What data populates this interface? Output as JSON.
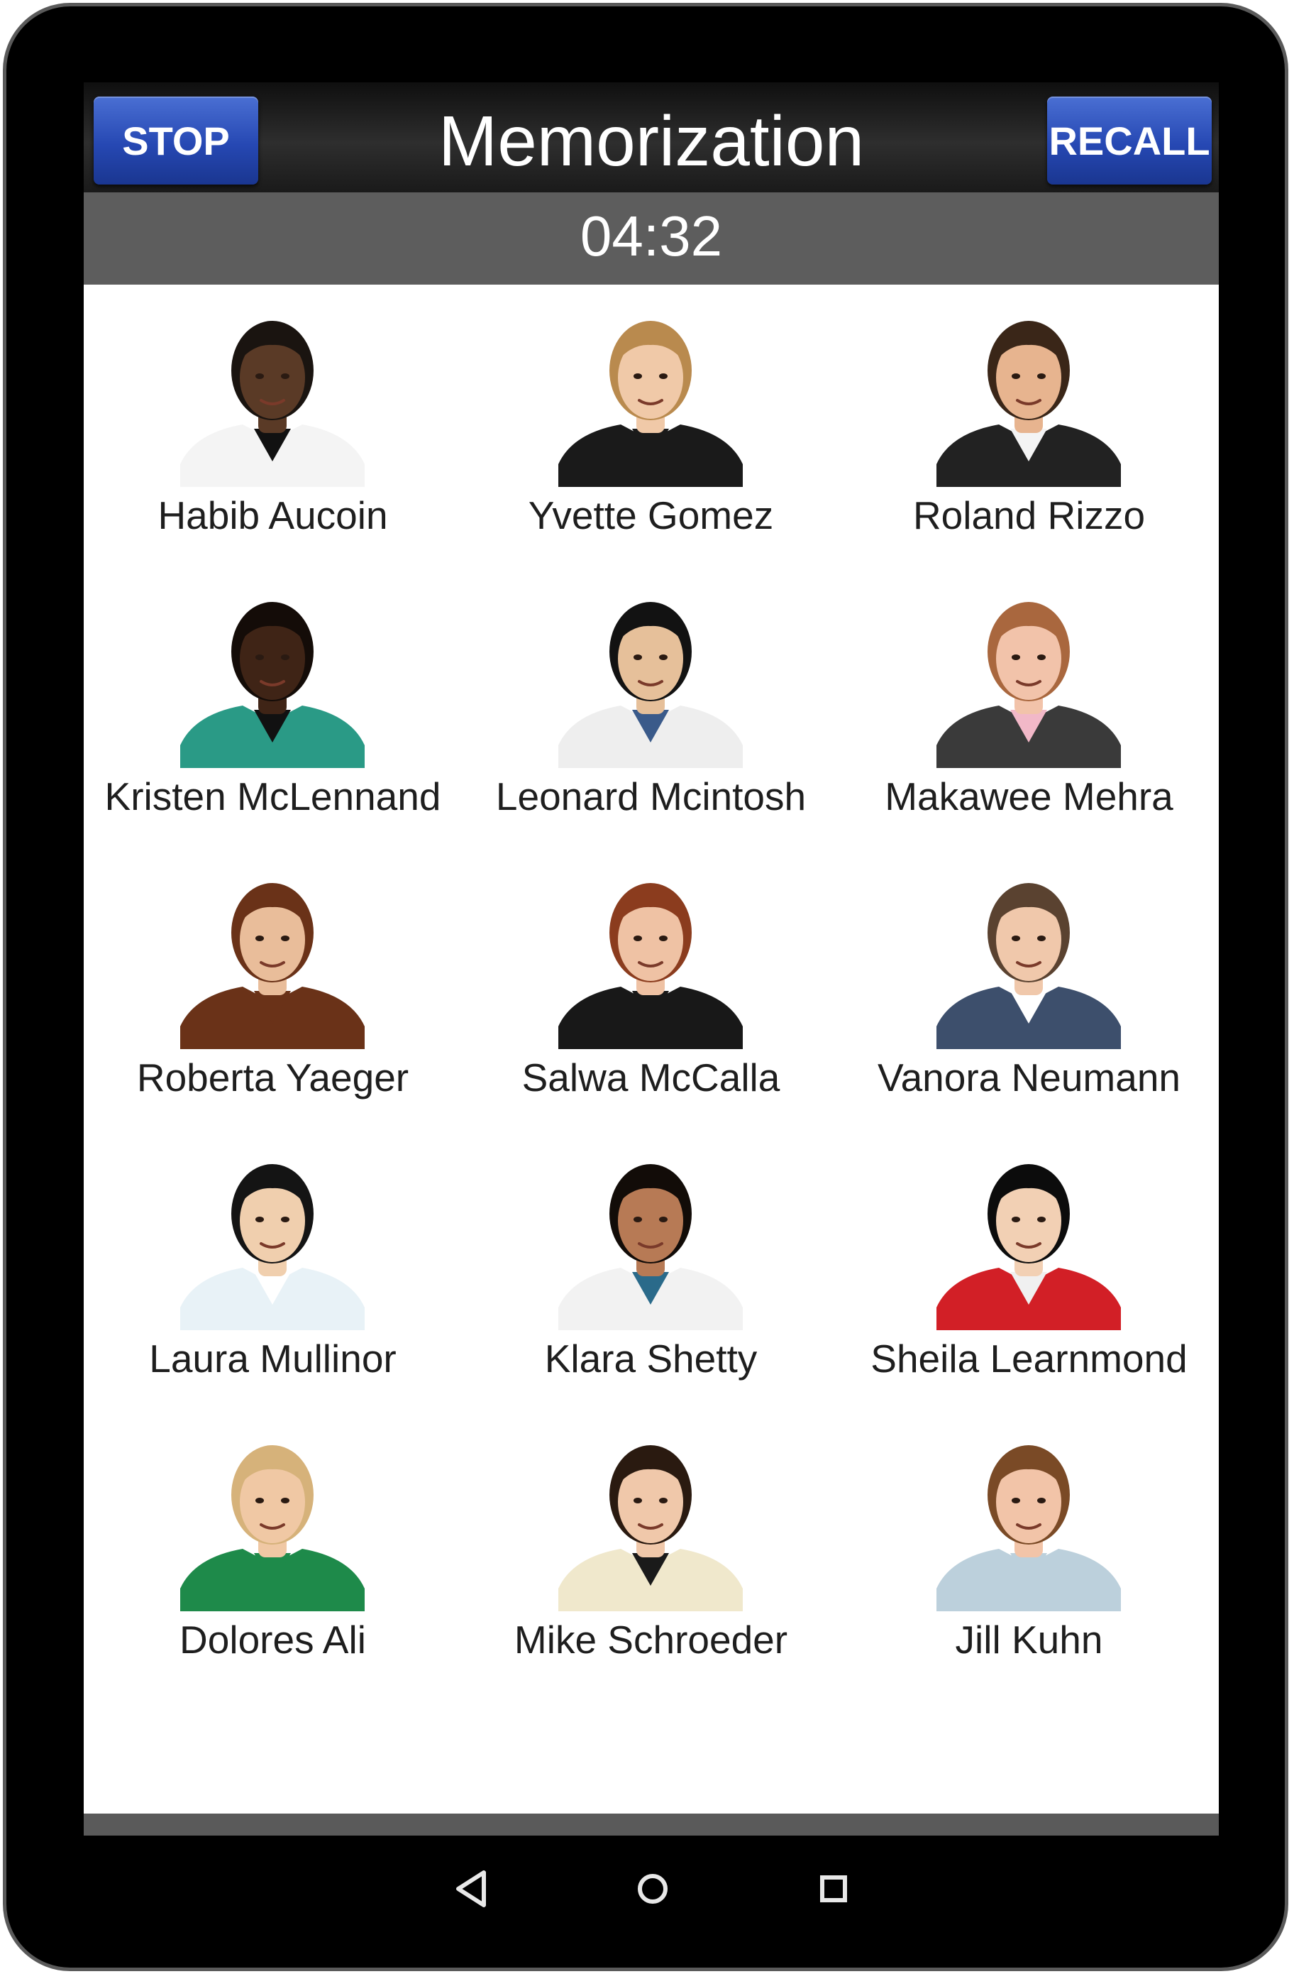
{
  "header": {
    "title": "Memorization",
    "stop_label": "STOP",
    "recall_label": "RECALL"
  },
  "timer": "04:32",
  "colors": {
    "button_blue": "#2648b3",
    "header_dark": "#1a1a1a",
    "timer_bar": "#5d5d5d"
  },
  "people": [
    {
      "name": "Habib Aucoin",
      "skin": "#5a3a26",
      "hair": "#1a1410",
      "shirt": "#f4f4f4",
      "shirt2": "#111111"
    },
    {
      "name": "Yvette Gomez",
      "skin": "#f0c9a8",
      "hair": "#b98a4e",
      "shirt": "#1a1a1a",
      "shirt2": "#1a1a1a"
    },
    {
      "name": "Roland Rizzo",
      "skin": "#e7b48f",
      "hair": "#3a2618",
      "shirt": "#222222",
      "shirt2": "#f4f4f4"
    },
    {
      "name": "Kristen McLennand",
      "skin": "#3f2416",
      "hair": "#140c08",
      "shirt": "#2a9a86",
      "shirt2": "#111111"
    },
    {
      "name": "Leonard Mcintosh",
      "skin": "#e6c09a",
      "hair": "#121212",
      "shirt": "#eeeeee",
      "shirt2": "#3a5a8a"
    },
    {
      "name": "Makawee Mehra",
      "skin": "#f2c3aa",
      "hair": "#a9673e",
      "shirt": "#3a3a3a",
      "shirt2": "#f2b8c8"
    },
    {
      "name": "Roberta Yaeger",
      "skin": "#e9bd9a",
      "hair": "#6a3218",
      "shirt": "#6a3218",
      "shirt2": "#6a3218"
    },
    {
      "name": "Salwa McCalla",
      "skin": "#efc2a4",
      "hair": "#8b3c1e",
      "shirt": "#181818",
      "shirt2": "#181818"
    },
    {
      "name": "Vanora Neumann",
      "skin": "#f0c8ab",
      "hair": "#5a4230",
      "shirt": "#3d4f6c",
      "shirt2": "#ffffff"
    },
    {
      "name": "Laura Mullinor",
      "skin": "#f0cfae",
      "hair": "#141414",
      "shirt": "#e8f2f7",
      "shirt2": "#ffffff"
    },
    {
      "name": "Klara Shetty",
      "skin": "#b77a55",
      "hair": "#120c08",
      "shirt": "#f2f2f2",
      "shirt2": "#2a6a8a"
    },
    {
      "name": "Sheila Learnmond",
      "skin": "#f2d0b4",
      "hair": "#0c0c0c",
      "shirt": "#d21f26",
      "shirt2": "#f0f0f0"
    },
    {
      "name": "Dolores Ali",
      "skin": "#f0c8a4",
      "hair": "#d6b27a",
      "shirt": "#1e8a4a",
      "shirt2": "#1e8a4a"
    },
    {
      "name": "Mike Schroeder",
      "skin": "#f0c8aa",
      "hair": "#2a1a10",
      "shirt": "#f0e8cc",
      "shirt2": "#1a1a1a"
    },
    {
      "name": "Jill Kuhn",
      "skin": "#f2c4a8",
      "hair": "#7a4a26",
      "shirt": "#bcd0dc",
      "shirt2": "#bcd0dc"
    }
  ],
  "navigation": {
    "back_icon": "back-triangle-icon",
    "home_icon": "home-circle-icon",
    "recents_icon": "recents-square-icon"
  }
}
